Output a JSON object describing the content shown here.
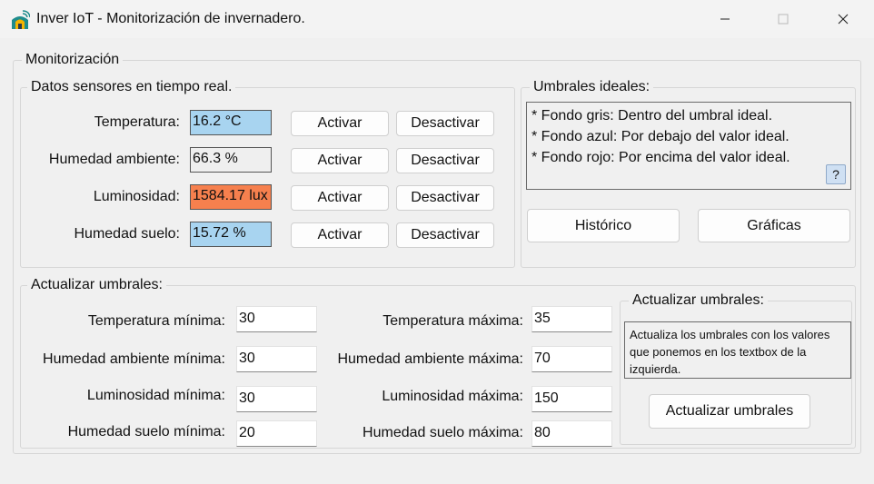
{
  "window": {
    "title": "Inver IoT - Monitorización de invernadero.",
    "app_icon": "greenhouse-wifi-icon",
    "controls": [
      "minimize-icon",
      "maximize-icon",
      "close-icon"
    ]
  },
  "monitor": {
    "title": "Monitorización",
    "sensors": {
      "title": "Datos sensores en tiempo real.",
      "rows": [
        {
          "label": "Temperatura:",
          "value": "16.2 °C",
          "status": "below",
          "color": "#a8d4f0",
          "activate": "Activar",
          "deactivate": "Desactivar"
        },
        {
          "label": "Humedad ambiente:",
          "value": "66.3 %",
          "status": "ideal",
          "color": "#efefef",
          "activate": "Activar",
          "deactivate": "Desactivar"
        },
        {
          "label": "Luminosidad:",
          "value": "1584.17 lux",
          "status": "above",
          "color": "#f6804e",
          "activate": "Activar",
          "deactivate": "Desactivar"
        },
        {
          "label": "Humedad suelo:",
          "value": "15.72 %",
          "status": "below",
          "color": "#a8d4f0",
          "activate": "Activar",
          "deactivate": "Desactivar"
        }
      ]
    },
    "ideal": {
      "title": "Umbrales ideales:",
      "lines": [
        "* Fondo gris: Dentro del umbral ideal.",
        "* Fondo azul: Por debajo del valor ideal.",
        "* Fondo rojo: Por encima del valor ideal."
      ],
      "help_label": "?",
      "history_label": "Histórico",
      "charts_label": "Gráficas"
    },
    "thresholds": {
      "title": "Actualizar umbrales:",
      "min": [
        {
          "label": "Temperatura mínima:",
          "value": "30"
        },
        {
          "label": "Humedad ambiente mínima:",
          "value": "30"
        },
        {
          "label": "Luminosidad mínima:",
          "value": "30"
        },
        {
          "label": "Humedad suelo mínima:",
          "value": "20"
        }
      ],
      "max": [
        {
          "label": "Temperatura máxima:",
          "value": "35"
        },
        {
          "label": "Humedad ambiente máxima:",
          "value": "70"
        },
        {
          "label": "Luminosidad máxima:",
          "value": "150"
        },
        {
          "label": "Humedad suelo máxima:",
          "value": "80"
        }
      ],
      "update_panel": {
        "title": "Actualizar umbrales:",
        "description": "Actualiza los umbrales con los valores que ponemos en los textbox de la izquierda.",
        "button_label": "Actualizar umbrales"
      }
    }
  }
}
